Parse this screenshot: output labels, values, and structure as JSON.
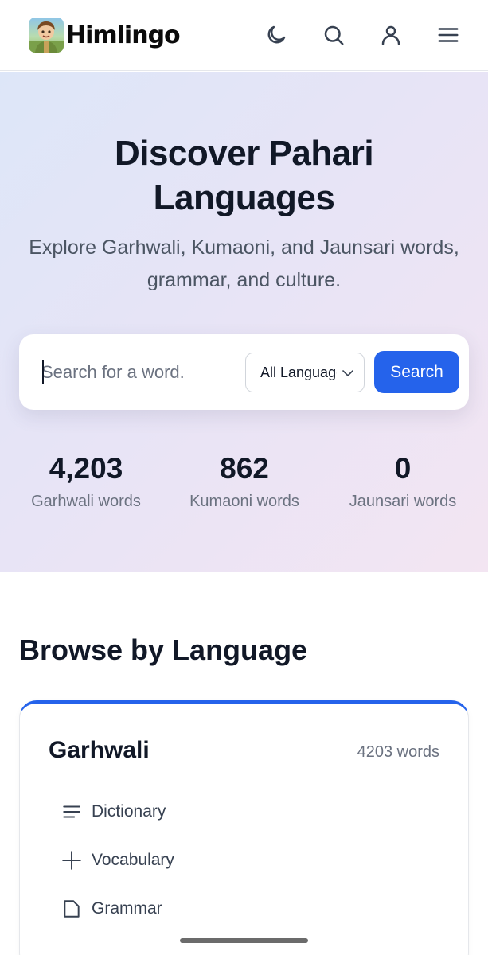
{
  "header": {
    "logo_text": "Himlingo",
    "icons": [
      "moon-icon",
      "search-icon",
      "user-icon",
      "menu-icon"
    ]
  },
  "hero": {
    "title": "Discover Pahari Languages",
    "subtitle": "Explore Garhwali, Kumaoni, and Jaunsari words, grammar, and culture.",
    "search": {
      "placeholder": "Search for a word.",
      "value": "",
      "language_selected": "All Languages",
      "button_label": "Search"
    },
    "stats": [
      {
        "value": "4,203",
        "label": "Garhwali words"
      },
      {
        "value": "862",
        "label": "Kumaoni words"
      },
      {
        "value": "0",
        "label": "Jaunsari words"
      }
    ]
  },
  "browse": {
    "title": "Browse by Language",
    "card": {
      "name": "Garhwali",
      "count": "4203 words",
      "items": [
        {
          "label": "Dictionary",
          "icon": "list-icon"
        },
        {
          "label": "Vocabulary",
          "icon": "plus-icon"
        },
        {
          "label": "Grammar",
          "icon": "document-icon"
        }
      ]
    }
  },
  "colors": {
    "accent": "#2563eb",
    "text_primary": "#111827",
    "text_secondary": "#6b7280"
  }
}
